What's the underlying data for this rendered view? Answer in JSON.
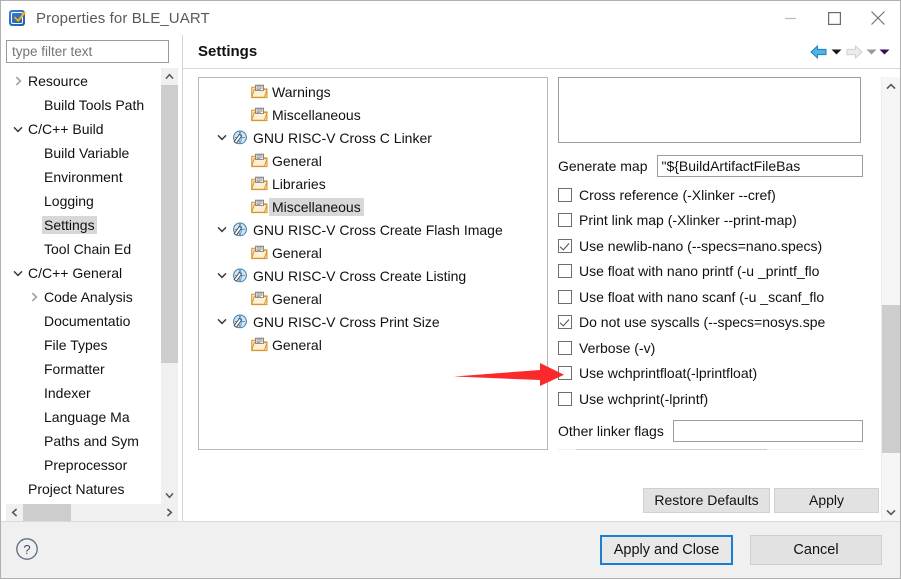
{
  "window": {
    "title": "Properties for BLE_UART",
    "icon": "app-checkmark-icon",
    "minimize": "minimize-icon",
    "maximize": "maximize-icon",
    "close": "close-icon"
  },
  "left": {
    "filter_placeholder": "type filter text",
    "filter_value": "",
    "tree": [
      {
        "label": "Resource",
        "indent": 1,
        "twisty": "collapsed",
        "selected": false
      },
      {
        "label": "Build Tools Path",
        "indent": 2,
        "twisty": "none",
        "selected": false
      },
      {
        "label": "C/C++ Build",
        "indent": 1,
        "twisty": "expanded",
        "selected": false
      },
      {
        "label": "Build Variable",
        "indent": 2,
        "twisty": "none",
        "selected": false
      },
      {
        "label": "Environment",
        "indent": 2,
        "twisty": "none",
        "selected": false
      },
      {
        "label": "Logging",
        "indent": 2,
        "twisty": "none",
        "selected": false
      },
      {
        "label": "Settings",
        "indent": 2,
        "twisty": "none",
        "selected": true
      },
      {
        "label": "Tool Chain Ed",
        "indent": 2,
        "twisty": "none",
        "selected": false
      },
      {
        "label": "C/C++ General",
        "indent": 1,
        "twisty": "expanded",
        "selected": false
      },
      {
        "label": "Code Analysis",
        "indent": 2,
        "twisty": "collapsed",
        "selected": false
      },
      {
        "label": "Documentatio",
        "indent": 2,
        "twisty": "none",
        "selected": false
      },
      {
        "label": "File Types",
        "indent": 2,
        "twisty": "none",
        "selected": false
      },
      {
        "label": "Formatter",
        "indent": 2,
        "twisty": "none",
        "selected": false
      },
      {
        "label": "Indexer",
        "indent": 2,
        "twisty": "none",
        "selected": false
      },
      {
        "label": "Language Ma",
        "indent": 2,
        "twisty": "none",
        "selected": false
      },
      {
        "label": "Paths and Sym",
        "indent": 2,
        "twisty": "none",
        "selected": false
      },
      {
        "label": "Preprocessor",
        "indent": 2,
        "twisty": "none",
        "selected": false
      },
      {
        "label": "Project Natures",
        "indent": 1,
        "twisty": "none",
        "selected": false
      }
    ]
  },
  "settings": {
    "title": "Settings",
    "nav": {
      "back_icon": "back-arrow-icon",
      "back_menu_icon": "chevron-down-icon",
      "forward_icon": "forward-arrow-icon",
      "forward_menu_icon": "chevron-down-icon",
      "overflow_icon": "chevron-down-icon"
    },
    "tool_tree": [
      {
        "label": "Warnings",
        "indent": 2,
        "twisty": "none",
        "icon": "folder-icon",
        "selected": false
      },
      {
        "label": "Miscellaneous",
        "indent": 2,
        "twisty": "none",
        "icon": "folder-icon",
        "selected": false
      },
      {
        "label": "GNU RISC-V Cross C Linker",
        "indent": 1,
        "twisty": "expanded",
        "icon": "tool-icon",
        "selected": false
      },
      {
        "label": "General",
        "indent": 2,
        "twisty": "none",
        "icon": "folder-icon",
        "selected": false
      },
      {
        "label": "Libraries",
        "indent": 2,
        "twisty": "none",
        "icon": "folder-icon",
        "selected": false
      },
      {
        "label": "Miscellaneous",
        "indent": 2,
        "twisty": "none",
        "icon": "folder-icon",
        "selected": true
      },
      {
        "label": "GNU RISC-V Cross Create Flash Image",
        "indent": 1,
        "twisty": "expanded",
        "icon": "tool-icon",
        "selected": false
      },
      {
        "label": "General",
        "indent": 2,
        "twisty": "none",
        "icon": "folder-icon",
        "selected": false
      },
      {
        "label": "GNU RISC-V Cross Create Listing",
        "indent": 1,
        "twisty": "expanded",
        "icon": "tool-icon",
        "selected": false
      },
      {
        "label": "General",
        "indent": 2,
        "twisty": "none",
        "icon": "folder-icon",
        "selected": false
      },
      {
        "label": "GNU RISC-V Cross Print Size",
        "indent": 1,
        "twisty": "expanded",
        "icon": "tool-icon",
        "selected": false
      },
      {
        "label": "General",
        "indent": 2,
        "twisty": "none",
        "icon": "folder-icon",
        "selected": false
      }
    ],
    "options": {
      "generate_map_label": "Generate map",
      "generate_map_value": "\"${BuildArtifactFileBas",
      "other_flags_label": "Other linker flags",
      "other_flags_value": "",
      "checkboxes": [
        {
          "label": "Cross reference (-Xlinker --cref)",
          "checked": false
        },
        {
          "label": "Print link map (-Xlinker --print-map)",
          "checked": false
        },
        {
          "label": "Use newlib-nano (--specs=nano.specs)",
          "checked": true
        },
        {
          "label": "Use float with nano printf (-u _printf_flo",
          "checked": false
        },
        {
          "label": "Use float with nano scanf (-u _scanf_flo",
          "checked": false
        },
        {
          "label": "Do not use syscalls (--specs=nosys.spe",
          "checked": true
        },
        {
          "label": "Verbose (-v)",
          "checked": false
        },
        {
          "label": "Use wchprintfloat(-lprintfloat)",
          "checked": false
        },
        {
          "label": "Use wchprint(-lprintf)",
          "checked": false
        }
      ]
    },
    "restore_defaults_label": "Restore Defaults",
    "apply_label": "Apply"
  },
  "footer": {
    "help_icon": "help-question-icon",
    "apply_and_close_label": "Apply and Close",
    "cancel_label": "Cancel"
  },
  "annotation": {
    "arrow": "red-pointer-arrow",
    "color": "#fb2a2a",
    "points_to": "Use wchprintfloat(-lprintfloat)"
  },
  "colors": {
    "accent": "#1a7fd4",
    "selection": "#d8d8d8",
    "scrollbar_thumb": "#cdcdcd",
    "dialog_bg": "#f0f0f0"
  }
}
